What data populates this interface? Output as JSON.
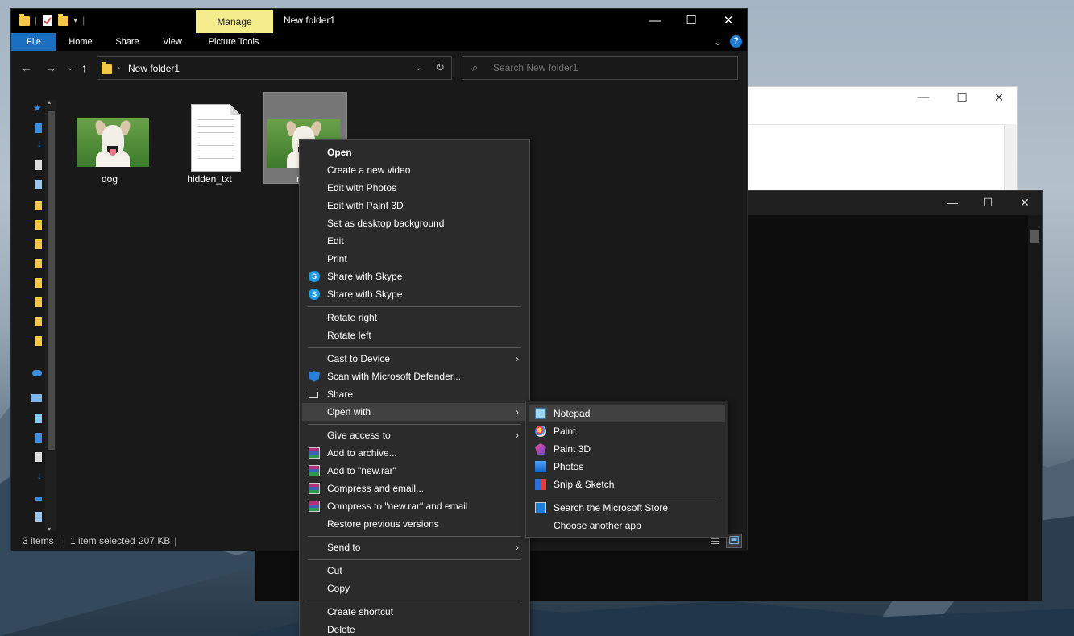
{
  "explorer": {
    "manage_tab": "Manage",
    "window_title": "New folder1",
    "ribbon_tabs": {
      "file": "File",
      "home": "Home",
      "share": "Share",
      "view": "View",
      "picture_tools": "Picture Tools"
    },
    "address_path": "New folder1",
    "search_placeholder": "Search New folder1",
    "files": [
      {
        "label": "dog"
      },
      {
        "label": "hidden_txt"
      },
      {
        "label": "n"
      }
    ],
    "status": {
      "count": "3 items",
      "selected": "1 item selected",
      "size": "207 KB"
    }
  },
  "context_menu": {
    "items": [
      "Open",
      "Create a new video",
      "Edit with Photos",
      "Edit with Paint 3D",
      "Set as desktop background",
      "Edit",
      "Print",
      "Share with Skype",
      "Share with Skype",
      "Rotate right",
      "Rotate left",
      "Cast to Device",
      "Scan with Microsoft Defender...",
      "Share",
      "Open with",
      "Give access to",
      "Add to archive...",
      "Add to \"new.rar\"",
      "Compress and email...",
      "Compress to \"new.rar\" and email",
      "Restore previous versions",
      "Send to",
      "Cut",
      "Copy",
      "Create shortcut",
      "Delete"
    ]
  },
  "open_with_menu": {
    "items": [
      "Notepad",
      "Paint",
      "Paint 3D",
      "Photos",
      "Snip & Sketch",
      "Search the Microsoft Store",
      "Choose another app"
    ]
  },
  "colors": {
    "accent": "#1a6fc0",
    "manage_tab": "#f5ec8e",
    "menu_bg": "#2b2b2b",
    "menu_hover": "#414141"
  }
}
